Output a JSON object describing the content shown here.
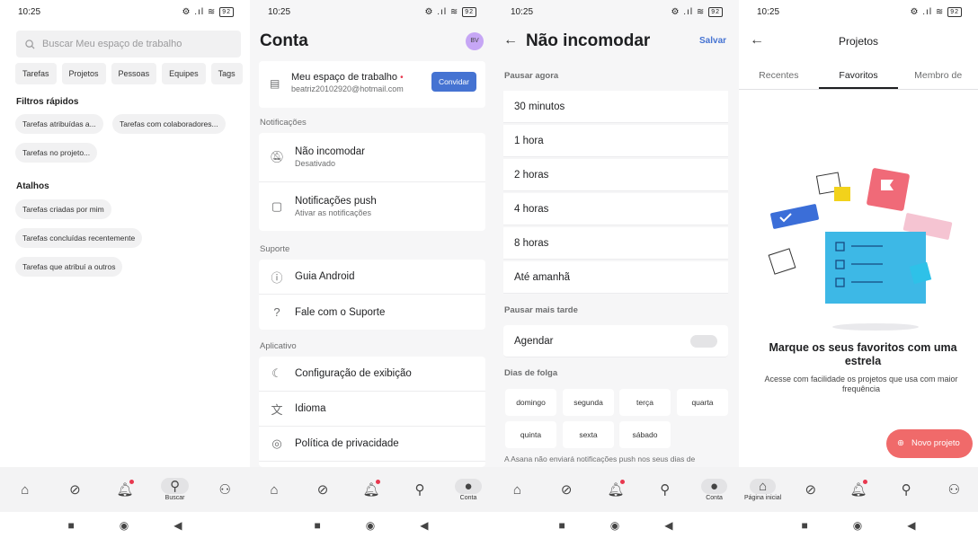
{
  "status": {
    "time": "10:25",
    "icons": "⚙ .ıl ≋",
    "battery": "92"
  },
  "screen1": {
    "search_placeholder": "Buscar Meu espaço de trabalho",
    "chips": [
      "Tarefas",
      "Projetos",
      "Pessoas",
      "Equipes",
      "Tags"
    ],
    "quick_filters_title": "Filtros rápidos",
    "quick_filters": [
      "Tarefas atribuídas a...",
      "Tarefas com colaboradores...",
      "Tarefas no projeto..."
    ],
    "shortcuts_title": "Atalhos",
    "shortcuts": [
      "Tarefas criadas por mim",
      "Tarefas concluídas recentemente",
      "Tarefas que atribuí a outros"
    ],
    "nav_active_label": "Buscar"
  },
  "screen2": {
    "title": "Conta",
    "avatar": "BV",
    "workspace_name": "Meu espaço de trabalho",
    "workspace_email": "beatriz20102920@hotmail.com",
    "invite": "Convidar",
    "notifications_label": "Notificações",
    "dnd_title": "Não incomodar",
    "dnd_sub": "Desativado",
    "push_title": "Notificações push",
    "push_sub": "Ativar as notificações",
    "support_label": "Suporte",
    "guide": "Guia Android",
    "contact": "Fale com o Suporte",
    "app_label": "Aplicativo",
    "display": "Configuração de exibição",
    "language": "Idioma",
    "privacy": "Política de privacidade",
    "nav_active_label": "Conta"
  },
  "screen3": {
    "title": "Não incomodar",
    "save": "Salvar",
    "pause_now": "Pausar agora",
    "options": [
      "30 minutos",
      "1 hora",
      "2 horas",
      "4 horas",
      "8 horas",
      "Até amanhã"
    ],
    "pause_later": "Pausar mais tarde",
    "schedule": "Agendar",
    "days_off": "Dias de folga",
    "days": [
      "domingo",
      "segunda",
      "terça",
      "quarta",
      "quinta",
      "sexta",
      "sábado"
    ],
    "note": "A Asana não enviará notificações push nos seus dias de",
    "nav_active_label": "Conta"
  },
  "screen4": {
    "title": "Projetos",
    "tabs": [
      "Recentes",
      "Favoritos",
      "Membro de"
    ],
    "empty_title_l1": "Marque os seus favoritos com uma",
    "empty_title_l2": "estrela",
    "empty_sub_l1": "Acesse com facilidade os projetos que usa com maior",
    "empty_sub_l2": "frequência",
    "new_project": "Novo projeto",
    "nav_active_label": "Página inicial"
  },
  "colors": {
    "accent": "#4573d2",
    "coral": "#f06a6a",
    "red": "#e8384f"
  }
}
